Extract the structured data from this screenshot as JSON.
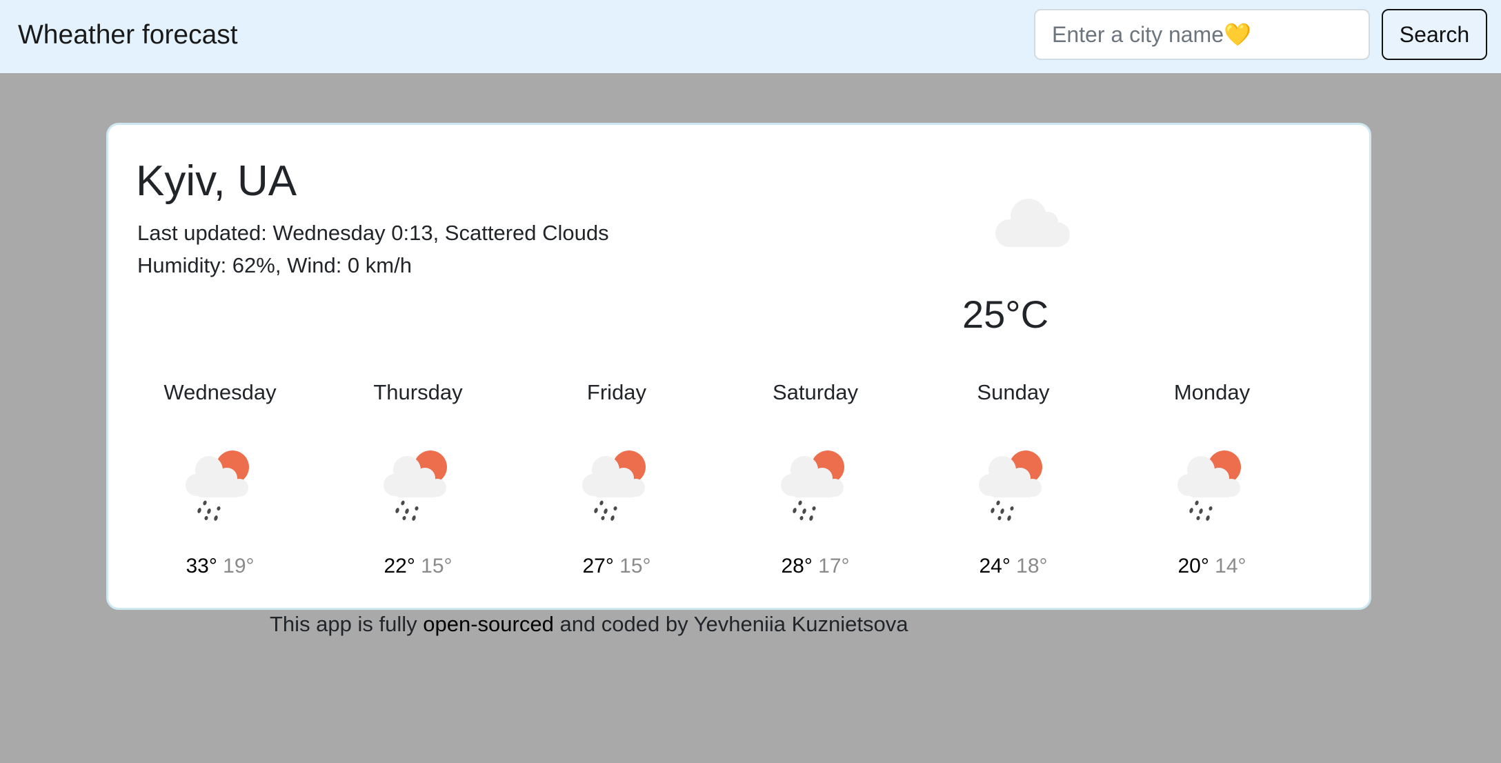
{
  "navbar": {
    "brand": "Wheather forecast",
    "search_placeholder": "Enter a city name💛",
    "search_value": "",
    "search_button": "Search"
  },
  "current": {
    "city": "Kyiv, UA",
    "last_updated_line": "Last updated: Wednesday 0:13, Scattered Clouds",
    "details_line": "Humidity: 62%, Wind: 0 km/h",
    "icon": "cloud-icon",
    "temperature": "25°C",
    "description": "Scattered Clouds",
    "humidity": "62%",
    "wind": "0 km/h"
  },
  "forecast": [
    {
      "day": "Wednesday",
      "icon": "rain-partly-sunny-icon",
      "max": "33°",
      "min": "19°"
    },
    {
      "day": "Thursday",
      "icon": "rain-partly-sunny-icon",
      "max": "22°",
      "min": "15°"
    },
    {
      "day": "Friday",
      "icon": "rain-partly-sunny-icon",
      "max": "27°",
      "min": "15°"
    },
    {
      "day": "Saturday",
      "icon": "rain-partly-sunny-icon",
      "max": "28°",
      "min": "17°"
    },
    {
      "day": "Sunday",
      "icon": "rain-partly-sunny-icon",
      "max": "24°",
      "min": "18°"
    },
    {
      "day": "Monday",
      "icon": "rain-partly-sunny-icon",
      "max": "20°",
      "min": "14°"
    }
  ],
  "footer": {
    "prefix": "This app is fully ",
    "link": "open-sourced",
    "suffix": " and coded by Yevheniia Kuznietsova"
  },
  "colors": {
    "navbar_bg": "#e3f2fd",
    "page_bg": "#a9a9a9",
    "sun": "#ec6e4c",
    "cloud": "#f1f1f1",
    "rain": "#4a4a4a",
    "min_temp": "#8a8a8a"
  }
}
